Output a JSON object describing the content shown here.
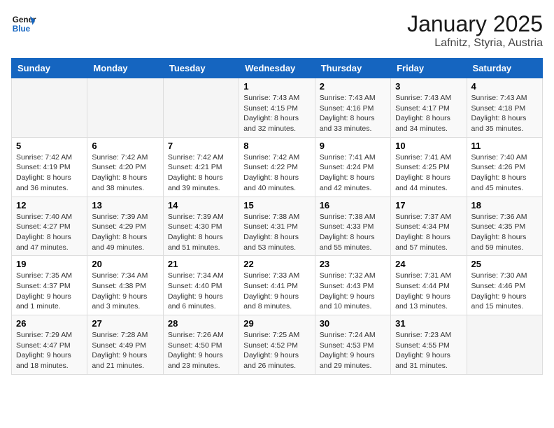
{
  "logo": {
    "line1": "General",
    "line2": "Blue"
  },
  "title": "January 2025",
  "subtitle": "Lafnitz, Styria, Austria",
  "weekdays": [
    "Sunday",
    "Monday",
    "Tuesday",
    "Wednesday",
    "Thursday",
    "Friday",
    "Saturday"
  ],
  "weeks": [
    [
      {
        "day": "",
        "info": ""
      },
      {
        "day": "",
        "info": ""
      },
      {
        "day": "",
        "info": ""
      },
      {
        "day": "1",
        "info": "Sunrise: 7:43 AM\nSunset: 4:15 PM\nDaylight: 8 hours\nand 32 minutes."
      },
      {
        "day": "2",
        "info": "Sunrise: 7:43 AM\nSunset: 4:16 PM\nDaylight: 8 hours\nand 33 minutes."
      },
      {
        "day": "3",
        "info": "Sunrise: 7:43 AM\nSunset: 4:17 PM\nDaylight: 8 hours\nand 34 minutes."
      },
      {
        "day": "4",
        "info": "Sunrise: 7:43 AM\nSunset: 4:18 PM\nDaylight: 8 hours\nand 35 minutes."
      }
    ],
    [
      {
        "day": "5",
        "info": "Sunrise: 7:42 AM\nSunset: 4:19 PM\nDaylight: 8 hours\nand 36 minutes."
      },
      {
        "day": "6",
        "info": "Sunrise: 7:42 AM\nSunset: 4:20 PM\nDaylight: 8 hours\nand 38 minutes."
      },
      {
        "day": "7",
        "info": "Sunrise: 7:42 AM\nSunset: 4:21 PM\nDaylight: 8 hours\nand 39 minutes."
      },
      {
        "day": "8",
        "info": "Sunrise: 7:42 AM\nSunset: 4:22 PM\nDaylight: 8 hours\nand 40 minutes."
      },
      {
        "day": "9",
        "info": "Sunrise: 7:41 AM\nSunset: 4:24 PM\nDaylight: 8 hours\nand 42 minutes."
      },
      {
        "day": "10",
        "info": "Sunrise: 7:41 AM\nSunset: 4:25 PM\nDaylight: 8 hours\nand 44 minutes."
      },
      {
        "day": "11",
        "info": "Sunrise: 7:40 AM\nSunset: 4:26 PM\nDaylight: 8 hours\nand 45 minutes."
      }
    ],
    [
      {
        "day": "12",
        "info": "Sunrise: 7:40 AM\nSunset: 4:27 PM\nDaylight: 8 hours\nand 47 minutes."
      },
      {
        "day": "13",
        "info": "Sunrise: 7:39 AM\nSunset: 4:29 PM\nDaylight: 8 hours\nand 49 minutes."
      },
      {
        "day": "14",
        "info": "Sunrise: 7:39 AM\nSunset: 4:30 PM\nDaylight: 8 hours\nand 51 minutes."
      },
      {
        "day": "15",
        "info": "Sunrise: 7:38 AM\nSunset: 4:31 PM\nDaylight: 8 hours\nand 53 minutes."
      },
      {
        "day": "16",
        "info": "Sunrise: 7:38 AM\nSunset: 4:33 PM\nDaylight: 8 hours\nand 55 minutes."
      },
      {
        "day": "17",
        "info": "Sunrise: 7:37 AM\nSunset: 4:34 PM\nDaylight: 8 hours\nand 57 minutes."
      },
      {
        "day": "18",
        "info": "Sunrise: 7:36 AM\nSunset: 4:35 PM\nDaylight: 8 hours\nand 59 minutes."
      }
    ],
    [
      {
        "day": "19",
        "info": "Sunrise: 7:35 AM\nSunset: 4:37 PM\nDaylight: 9 hours\nand 1 minute."
      },
      {
        "day": "20",
        "info": "Sunrise: 7:34 AM\nSunset: 4:38 PM\nDaylight: 9 hours\nand 3 minutes."
      },
      {
        "day": "21",
        "info": "Sunrise: 7:34 AM\nSunset: 4:40 PM\nDaylight: 9 hours\nand 6 minutes."
      },
      {
        "day": "22",
        "info": "Sunrise: 7:33 AM\nSunset: 4:41 PM\nDaylight: 9 hours\nand 8 minutes."
      },
      {
        "day": "23",
        "info": "Sunrise: 7:32 AM\nSunset: 4:43 PM\nDaylight: 9 hours\nand 10 minutes."
      },
      {
        "day": "24",
        "info": "Sunrise: 7:31 AM\nSunset: 4:44 PM\nDaylight: 9 hours\nand 13 minutes."
      },
      {
        "day": "25",
        "info": "Sunrise: 7:30 AM\nSunset: 4:46 PM\nDaylight: 9 hours\nand 15 minutes."
      }
    ],
    [
      {
        "day": "26",
        "info": "Sunrise: 7:29 AM\nSunset: 4:47 PM\nDaylight: 9 hours\nand 18 minutes."
      },
      {
        "day": "27",
        "info": "Sunrise: 7:28 AM\nSunset: 4:49 PM\nDaylight: 9 hours\nand 21 minutes."
      },
      {
        "day": "28",
        "info": "Sunrise: 7:26 AM\nSunset: 4:50 PM\nDaylight: 9 hours\nand 23 minutes."
      },
      {
        "day": "29",
        "info": "Sunrise: 7:25 AM\nSunset: 4:52 PM\nDaylight: 9 hours\nand 26 minutes."
      },
      {
        "day": "30",
        "info": "Sunrise: 7:24 AM\nSunset: 4:53 PM\nDaylight: 9 hours\nand 29 minutes."
      },
      {
        "day": "31",
        "info": "Sunrise: 7:23 AM\nSunset: 4:55 PM\nDaylight: 9 hours\nand 31 minutes."
      },
      {
        "day": "",
        "info": ""
      }
    ]
  ]
}
